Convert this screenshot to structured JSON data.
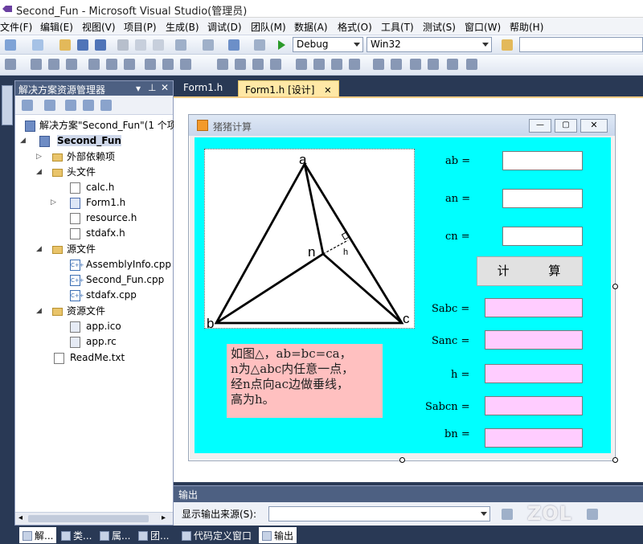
{
  "window": {
    "title": "Second_Fun - Microsoft Visual Studio(管理员)"
  },
  "menu": [
    "文件(F)",
    "编辑(E)",
    "视图(V)",
    "项目(P)",
    "生成(B)",
    "调试(D)",
    "团队(M)",
    "数据(A)",
    "格式(O)",
    "工具(T)",
    "测试(S)",
    "窗口(W)",
    "帮助(H)"
  ],
  "toolbar": {
    "config": "Debug",
    "platform": "Win32"
  },
  "solution_explorer": {
    "title": "解决方案资源管理器",
    "solution": "解决方案\"Second_Fun\"(1 个项",
    "project": "Second_Fun",
    "items": [
      {
        "label": "外部依赖项",
        "icon": "folder-icon"
      },
      {
        "label": "头文件",
        "icon": "folder-icon"
      },
      {
        "label": "calc.h",
        "icon": "header-file-icon"
      },
      {
        "label": "Form1.h",
        "icon": "form-icon"
      },
      {
        "label": "resource.h",
        "icon": "header-file-icon"
      },
      {
        "label": "stdafx.h",
        "icon": "header-file-icon"
      },
      {
        "label": "源文件",
        "icon": "folder-icon"
      },
      {
        "label": "AssemblyInfo.cpp",
        "icon": "cpp-file-icon"
      },
      {
        "label": "Second_Fun.cpp",
        "icon": "cpp-file-icon"
      },
      {
        "label": "stdafx.cpp",
        "icon": "cpp-file-icon"
      },
      {
        "label": "资源文件",
        "icon": "folder-icon"
      },
      {
        "label": "app.ico",
        "icon": "icon-file-icon"
      },
      {
        "label": "app.rc",
        "icon": "rc-file-icon"
      },
      {
        "label": "ReadMe.txt",
        "icon": "text-file-icon"
      }
    ]
  },
  "tabs": [
    {
      "label": "Form1.h"
    },
    {
      "label": "Form1.h [设计]"
    }
  ],
  "form": {
    "title": "猪猪计算",
    "diagram_labels": {
      "a": "a",
      "b": "b",
      "c": "c",
      "n": "n",
      "h": "h"
    },
    "inputs": [
      {
        "label": "ab =",
        "value": ""
      },
      {
        "label": "an =",
        "value": ""
      },
      {
        "label": "cn =",
        "value": ""
      }
    ],
    "button": "计 算",
    "outputs": [
      {
        "label": "Sabc =",
        "value": ""
      },
      {
        "label": "Sanc =",
        "value": ""
      },
      {
        "label": "h =",
        "value": ""
      },
      {
        "label": "Sabcn =",
        "value": ""
      },
      {
        "label": "bn =",
        "value": ""
      }
    ],
    "note": {
      "line1": "如图△，ab=bc=ca，",
      "line2": "n为△abc内任意一点，",
      "line3": "经n点向ac边做垂线，",
      "line4": "高为h。"
    }
  },
  "output": {
    "title": "输出",
    "source_label": "显示输出来源(S):",
    "source_value": ""
  },
  "bottom_tabs": [
    "解...",
    "类...",
    "属...",
    "团...",
    "代码定义窗口",
    "输出"
  ],
  "watermark": "ZOL",
  "colors": {
    "client_bg": "#00ffff",
    "output_box": "#ffccff",
    "note_bg": "#ffc0c0",
    "vs_frame": "#293955"
  }
}
